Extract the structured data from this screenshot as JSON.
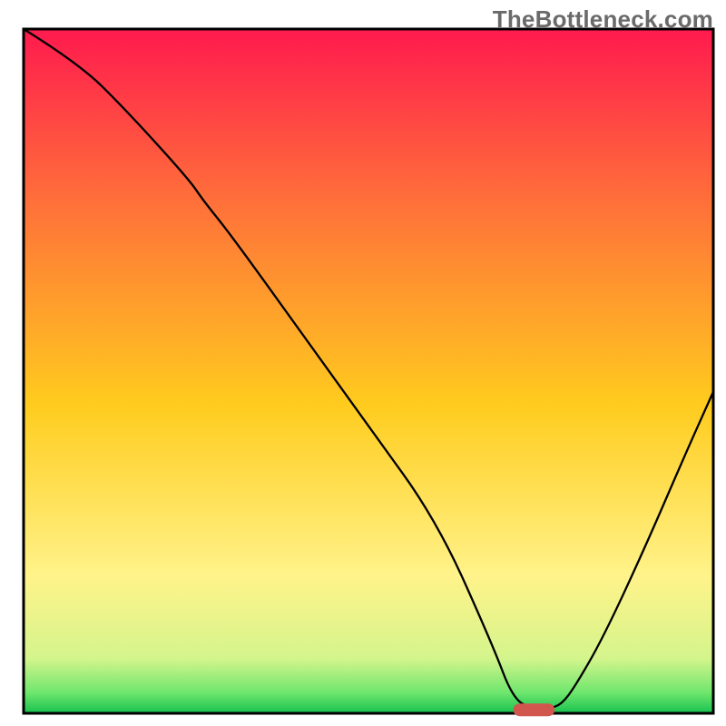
{
  "watermark": "TheBottleneck.com",
  "chart_data": {
    "type": "line",
    "title": "",
    "xlabel": "",
    "ylabel": "",
    "xlim": [
      0,
      100
    ],
    "ylim": [
      0,
      100
    ],
    "legend": false,
    "background_gradient": {
      "type": "vertical",
      "stops": [
        {
          "offset": 0.0,
          "color": "#ff1a4e"
        },
        {
          "offset": 0.25,
          "color": "#ff6f3a"
        },
        {
          "offset": 0.55,
          "color": "#ffcc1e"
        },
        {
          "offset": 0.8,
          "color": "#fff38a"
        },
        {
          "offset": 0.92,
          "color": "#d4f58c"
        },
        {
          "offset": 0.97,
          "color": "#6ee66e"
        },
        {
          "offset": 1.0,
          "color": "#17c24e"
        }
      ]
    },
    "marker": {
      "x_range": [
        71,
        77
      ],
      "y": 0.5,
      "color": "#d1574e"
    },
    "series": [
      {
        "name": "curve",
        "color": "#000000",
        "width": 2.3,
        "x": [
          0,
          8,
          15,
          24,
          26,
          30,
          40,
          50,
          60,
          68,
          71,
          74,
          76,
          78,
          80,
          84,
          90,
          96,
          100
        ],
        "y": [
          100,
          95,
          88,
          78,
          75,
          70,
          56,
          42,
          28,
          10,
          2,
          0.6,
          0.6,
          1.3,
          4,
          11,
          24,
          38,
          47
        ]
      }
    ]
  }
}
